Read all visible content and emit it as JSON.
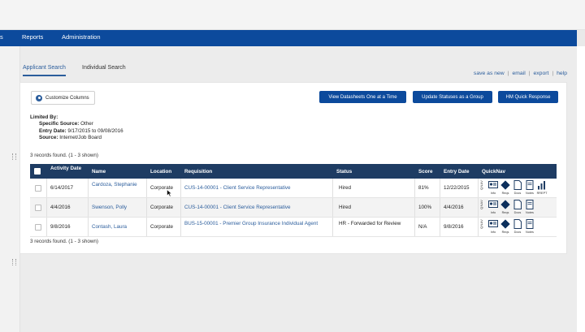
{
  "nav": {
    "items": [
      "s",
      "Reports",
      "Administration"
    ]
  },
  "tabs": {
    "applicant": "Applicant Search",
    "individual": "Individual Search"
  },
  "quick_links": [
    "save as new",
    "email",
    "export",
    "help"
  ],
  "toolbar": {
    "customize": "Customize Columns",
    "view_datasheets": "View Datasheets One at a Time",
    "update_statuses": "Update Statuses as a Group",
    "hm_quick": "HM Quick Response"
  },
  "filters": {
    "title": "Limited By:",
    "lines": [
      {
        "label": "Specific Source:",
        "value": "Other"
      },
      {
        "label": "Entry Date:",
        "value": "9/17/2015 to 09/08/2016"
      },
      {
        "label": "Source:",
        "value": "Internet/Job Board"
      }
    ]
  },
  "records_text": "3 records found. (1 - 3 shown)",
  "table": {
    "headers": {
      "activity": "Activity Date",
      "name": "Name",
      "location": "Location",
      "requisition": "Requisition",
      "status": "Status",
      "score": "Score",
      "entry": "Entry Date",
      "quicknav": "QuickNav"
    },
    "rows": [
      {
        "activity": "6/14/2017",
        "name": "Cardoza, Stephanie",
        "location": "Corporate",
        "requisition": "CUS-14-00001 - Client Service Representative",
        "status": "Hired",
        "score": "81%",
        "entry": "12/22/2015"
      },
      {
        "activity": "4/4/2016",
        "name": "Swenson, Polly",
        "location": "Corporate",
        "requisition": "CUS-14-00001 - Client Service Representative",
        "status": "Hired",
        "score": "100%",
        "entry": "4/4/2016"
      },
      {
        "activity": "9/8/2016",
        "name": "Contash, Laura",
        "location": "Corporate",
        "requisition": "BUS-15-00001 - Premier Group Insurance Individual Agent",
        "status": "HR - Forwarded for Review",
        "score": "N/A",
        "entry": "9/8/2016"
      }
    ],
    "quicknav": {
      "label": "QNAV",
      "caps": [
        "Info",
        "Reqs",
        "Docs",
        "Notes",
        "RREPT"
      ]
    }
  },
  "colors": {
    "nav": "#0c4a9c",
    "header": "#1e3c63",
    "link": "#2b5d9c"
  }
}
